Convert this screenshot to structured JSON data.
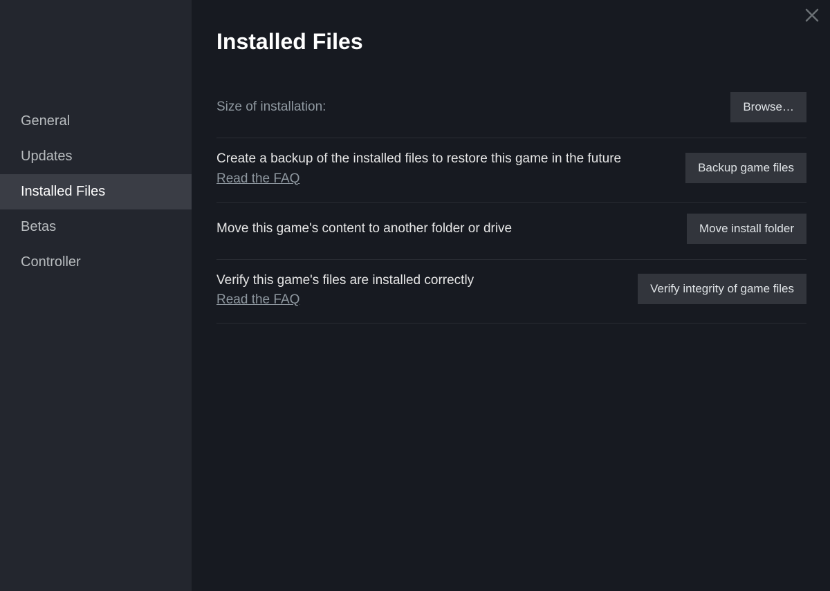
{
  "sidebar": {
    "items": [
      {
        "label": "General",
        "active": false
      },
      {
        "label": "Updates",
        "active": false
      },
      {
        "label": "Installed Files",
        "active": true
      },
      {
        "label": "Betas",
        "active": false
      },
      {
        "label": "Controller",
        "active": false
      }
    ]
  },
  "main": {
    "title": "Installed Files",
    "size_row": {
      "label": "Size of installation:",
      "button": "Browse…"
    },
    "backup_row": {
      "desc": "Create a backup of the installed files to restore this game in the future",
      "faq": "Read the FAQ",
      "button": "Backup game files"
    },
    "move_row": {
      "desc": "Move this game's content to another folder or drive",
      "button": "Move install folder"
    },
    "verify_row": {
      "desc": "Verify this game's files are installed correctly",
      "faq": "Read the FAQ",
      "button": "Verify integrity of game files"
    }
  }
}
